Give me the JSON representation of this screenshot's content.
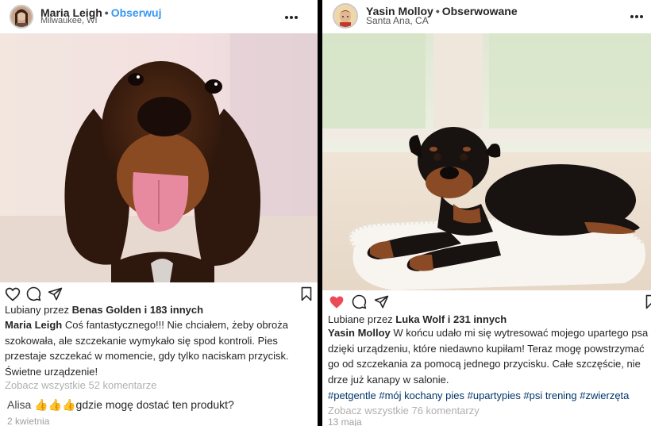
{
  "post1": {
    "user": "Maria Leigh",
    "follow_label": "Obserwuj",
    "location": "Milwaukee, WI",
    "likes_prefix": "Lubiany przez",
    "likes_user": "Benas Golden",
    "likes_suffix": "i 183 innych",
    "caption_user": "Maria Leigh",
    "caption_text": "Coś fantastycznego!!! Nie chciałem, żeby obroża szokowała, ale szczekanie wymykało się spod kontroli. Pies przestaje szczekać w momencie, gdy tylko naciskam przycisk. Świetne urządzenie!",
    "view_all": "Zobacz wszystkie 52 komentarze",
    "comment_user": "Alisa",
    "comment_emoji": "👍👍👍",
    "comment_text": "gdzie mogę dostać ten produkt?",
    "date": "2 kwietnia",
    "liked": false
  },
  "post2": {
    "user": "Yasin Molloy",
    "follow_label": "Obserwowane",
    "location": "Santa Ana, CA",
    "likes_prefix": "Lubiane przez",
    "likes_user": "Luka Wolf",
    "likes_suffix": "i 231 innych",
    "caption_user": "Yasin Molloy",
    "caption_text": "W końcu udało mi się wytresować mojego upartego psa dzięki urządzeniu, które niedawno kupiłam! Teraz mogę powstrzymać go od szczekania za pomocą jednego przycisku. Całe szczęście, nie drze już kanapy w salonie.",
    "hashtags": "#petgentle #mój kochany pies #upartypies #psi trening #zwierzęta",
    "view_all": "Zobacz wszystkie 76 komentarzy",
    "date": "13 maja",
    "liked": true,
    "heart_color": "#ed4956"
  },
  "colors": {
    "follow_blue": "#3897f0",
    "hashtag": "#003569",
    "muted": "#b0b0b0"
  }
}
